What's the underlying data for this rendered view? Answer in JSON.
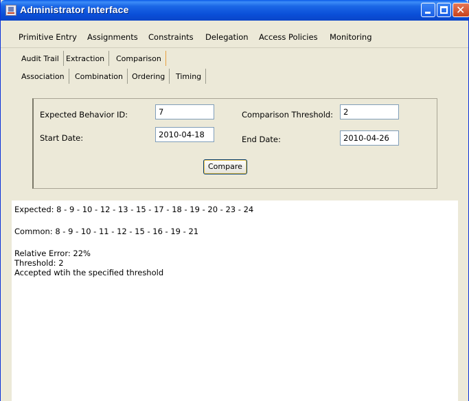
{
  "window": {
    "title": "Administrator Interface"
  },
  "menu": [
    "Primitive Entry",
    "Assignments",
    "Constraints",
    "Delegation",
    "Access Policies",
    "Monitoring"
  ],
  "tabs_primary": [
    "Audit Trail",
    "Extraction",
    "Comparison"
  ],
  "tabs_secondary": [
    "Association",
    "Combination",
    "Ordering",
    "Timing"
  ],
  "form": {
    "behavior_label": "Expected Behavior ID:",
    "behavior_value": "7",
    "threshold_label": "Comparison Threshold:",
    "threshold_value": "2",
    "start_label": "Start Date:",
    "start_value": "2010-04-18",
    "end_label": "End Date:",
    "end_value": "2010-04-26",
    "compare_label": "Compare"
  },
  "output": {
    "expected": "Expected: 8 - 9 - 10 - 12 - 13 - 15 - 17 - 18 - 19 - 20 - 23 - 24",
    "common": "Common: 8 - 9 - 10 - 11 - 12 - 15 - 16 - 19 - 21",
    "relative_error": "Relative Error: 22%",
    "threshold": "Threshold: 2",
    "result": "Accepted wtih the specified threshold"
  },
  "colors": {
    "titlebar": "#0a4fd8",
    "window_bg": "#ece9d8",
    "close_button": "#c8421c",
    "field_border": "#7f9db9"
  }
}
